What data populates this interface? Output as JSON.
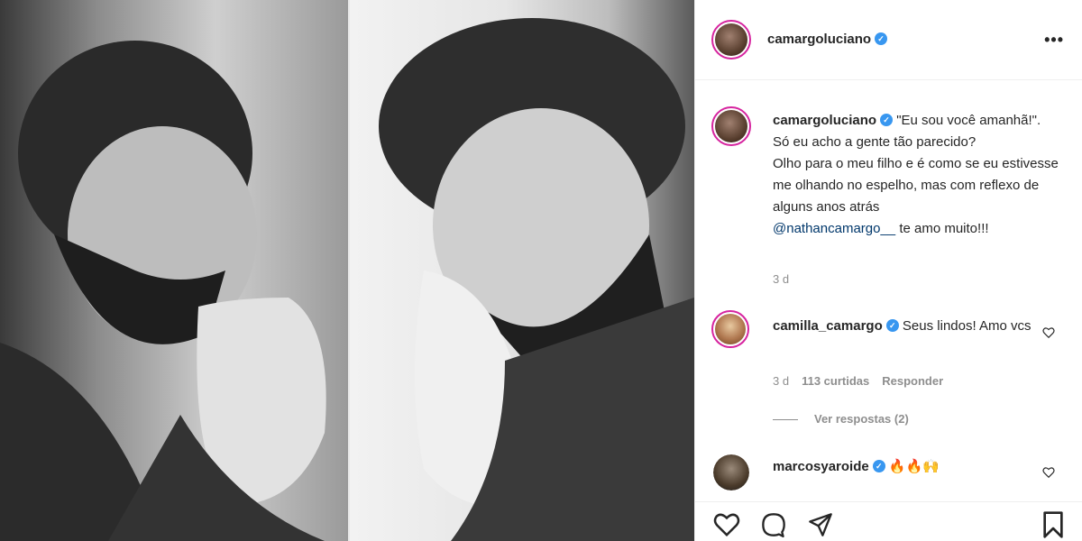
{
  "post": {
    "author": "camargoluciano",
    "verified": true,
    "more_label": "•••"
  },
  "caption": {
    "username": "camargoluciano",
    "line1": "\"Eu sou você amanhã!\".",
    "line2": "Só eu acho a gente tão parecido?",
    "line3": "Olho para o meu filho e é como se eu estivesse me olhando no espelho, mas com reflexo de alguns anos atrás",
    "mention": "@nathancamargo__",
    "tail": " te amo muito!!!",
    "time": "3 d"
  },
  "comments": [
    {
      "username": "camilla_camargo",
      "text": "Seus lindos! Amo vcs",
      "time": "3 d",
      "likes": "113 curtidas",
      "reply_label": "Responder",
      "view_replies": "Ver respostas (2)"
    },
    {
      "username": "marcosyaroide",
      "text": "🔥🔥🙌"
    }
  ],
  "icons": {
    "like": "heart-icon",
    "comment": "comment-icon",
    "share": "share-icon",
    "save": "bookmark-icon"
  },
  "colors": {
    "verified": "#3897f0",
    "mention": "#00376b",
    "ring": "#d6249f",
    "muted": "#8e8e8e"
  }
}
